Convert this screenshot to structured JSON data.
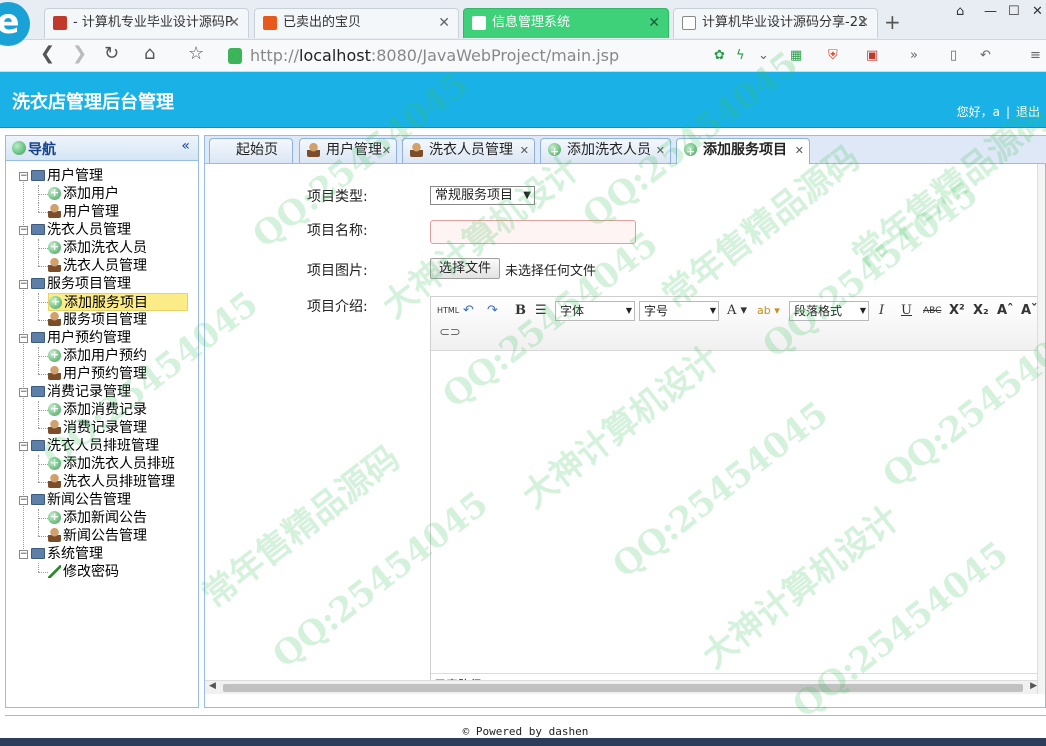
{
  "browser": {
    "tabs": [
      {
        "title": "- 计算机专业毕业设计源码P"
      },
      {
        "title": "已卖出的宝贝"
      },
      {
        "title": "信息管理系统"
      },
      {
        "title": "计算机毕业设计源码分享-22"
      }
    ],
    "url_prefix": "http://",
    "url_host": "localhost",
    "url_rest": ":8080/JavaWebProject/main.jsp"
  },
  "header": {
    "title": "洗衣店管理后台管理",
    "greeting": "您好，a",
    "logout": "退出"
  },
  "sidebar": {
    "title": "导航",
    "collapse_glyph": "«",
    "groups": [
      {
        "label": "用户管理",
        "items": [
          {
            "label": "添加用户",
            "icon": "add"
          },
          {
            "label": "用户管理",
            "icon": "user"
          }
        ]
      },
      {
        "label": "洗衣人员管理",
        "items": [
          {
            "label": "添加洗衣人员",
            "icon": "add"
          },
          {
            "label": "洗衣人员管理",
            "icon": "user"
          }
        ]
      },
      {
        "label": "服务项目管理",
        "items": [
          {
            "label": "添加服务项目",
            "icon": "add"
          },
          {
            "label": "服务项目管理",
            "icon": "user"
          }
        ]
      },
      {
        "label": "用户预约管理",
        "items": [
          {
            "label": "添加用户预约",
            "icon": "add"
          },
          {
            "label": "用户预约管理",
            "icon": "user"
          }
        ]
      },
      {
        "label": "消费记录管理",
        "items": [
          {
            "label": "添加消费记录",
            "icon": "add"
          },
          {
            "label": "消费记录管理",
            "icon": "user"
          }
        ]
      },
      {
        "label": "洗衣人员排班管理",
        "items": [
          {
            "label": "添加洗衣人员排班",
            "icon": "add"
          },
          {
            "label": "洗衣人员排班管理",
            "icon": "user"
          }
        ]
      },
      {
        "label": "新闻公告管理",
        "items": [
          {
            "label": "添加新闻公告",
            "icon": "add"
          },
          {
            "label": "新闻公告管理",
            "icon": "user"
          }
        ]
      },
      {
        "label": "系统管理",
        "items": [
          {
            "label": "修改密码",
            "icon": "pen"
          }
        ]
      }
    ]
  },
  "tabs": [
    {
      "label": "起始页",
      "icon": "none",
      "closable": false
    },
    {
      "label": "用户管理",
      "icon": "user",
      "closable": true
    },
    {
      "label": "洗衣人员管理",
      "icon": "user",
      "closable": true
    },
    {
      "label": "添加洗衣人员",
      "icon": "add",
      "closable": true
    },
    {
      "label": "添加服务项目",
      "icon": "add",
      "closable": true
    }
  ],
  "form": {
    "type_label": "项目类型:",
    "type_value": "常规服务项目",
    "name_label": "项目名称:",
    "name_value": "",
    "image_label": "项目图片:",
    "file_button": "选择文件",
    "file_status": "未选择任何文件",
    "intro_label": "项目介绍:"
  },
  "editor": {
    "html_btn": "HTML",
    "bold": "B",
    "font_family": "字体",
    "font_size": "字号",
    "font_color": "A",
    "paragraph": "段落格式",
    "italic": "I",
    "underline": "U",
    "strike": "ABC",
    "superscript": "X²",
    "subscript": "X₂",
    "element_path": "元素路径:"
  },
  "footer": {
    "text": "© Powered by dashen"
  },
  "watermark": {
    "qq": "QQ:25454045",
    "text_a": "大神计算机设计",
    "text_b": "常年售精品源码"
  },
  "colors": {
    "header_bg": "#19b1e6",
    "active_browser_tab": "#3fd07a",
    "selected_node": "#fbec88"
  }
}
